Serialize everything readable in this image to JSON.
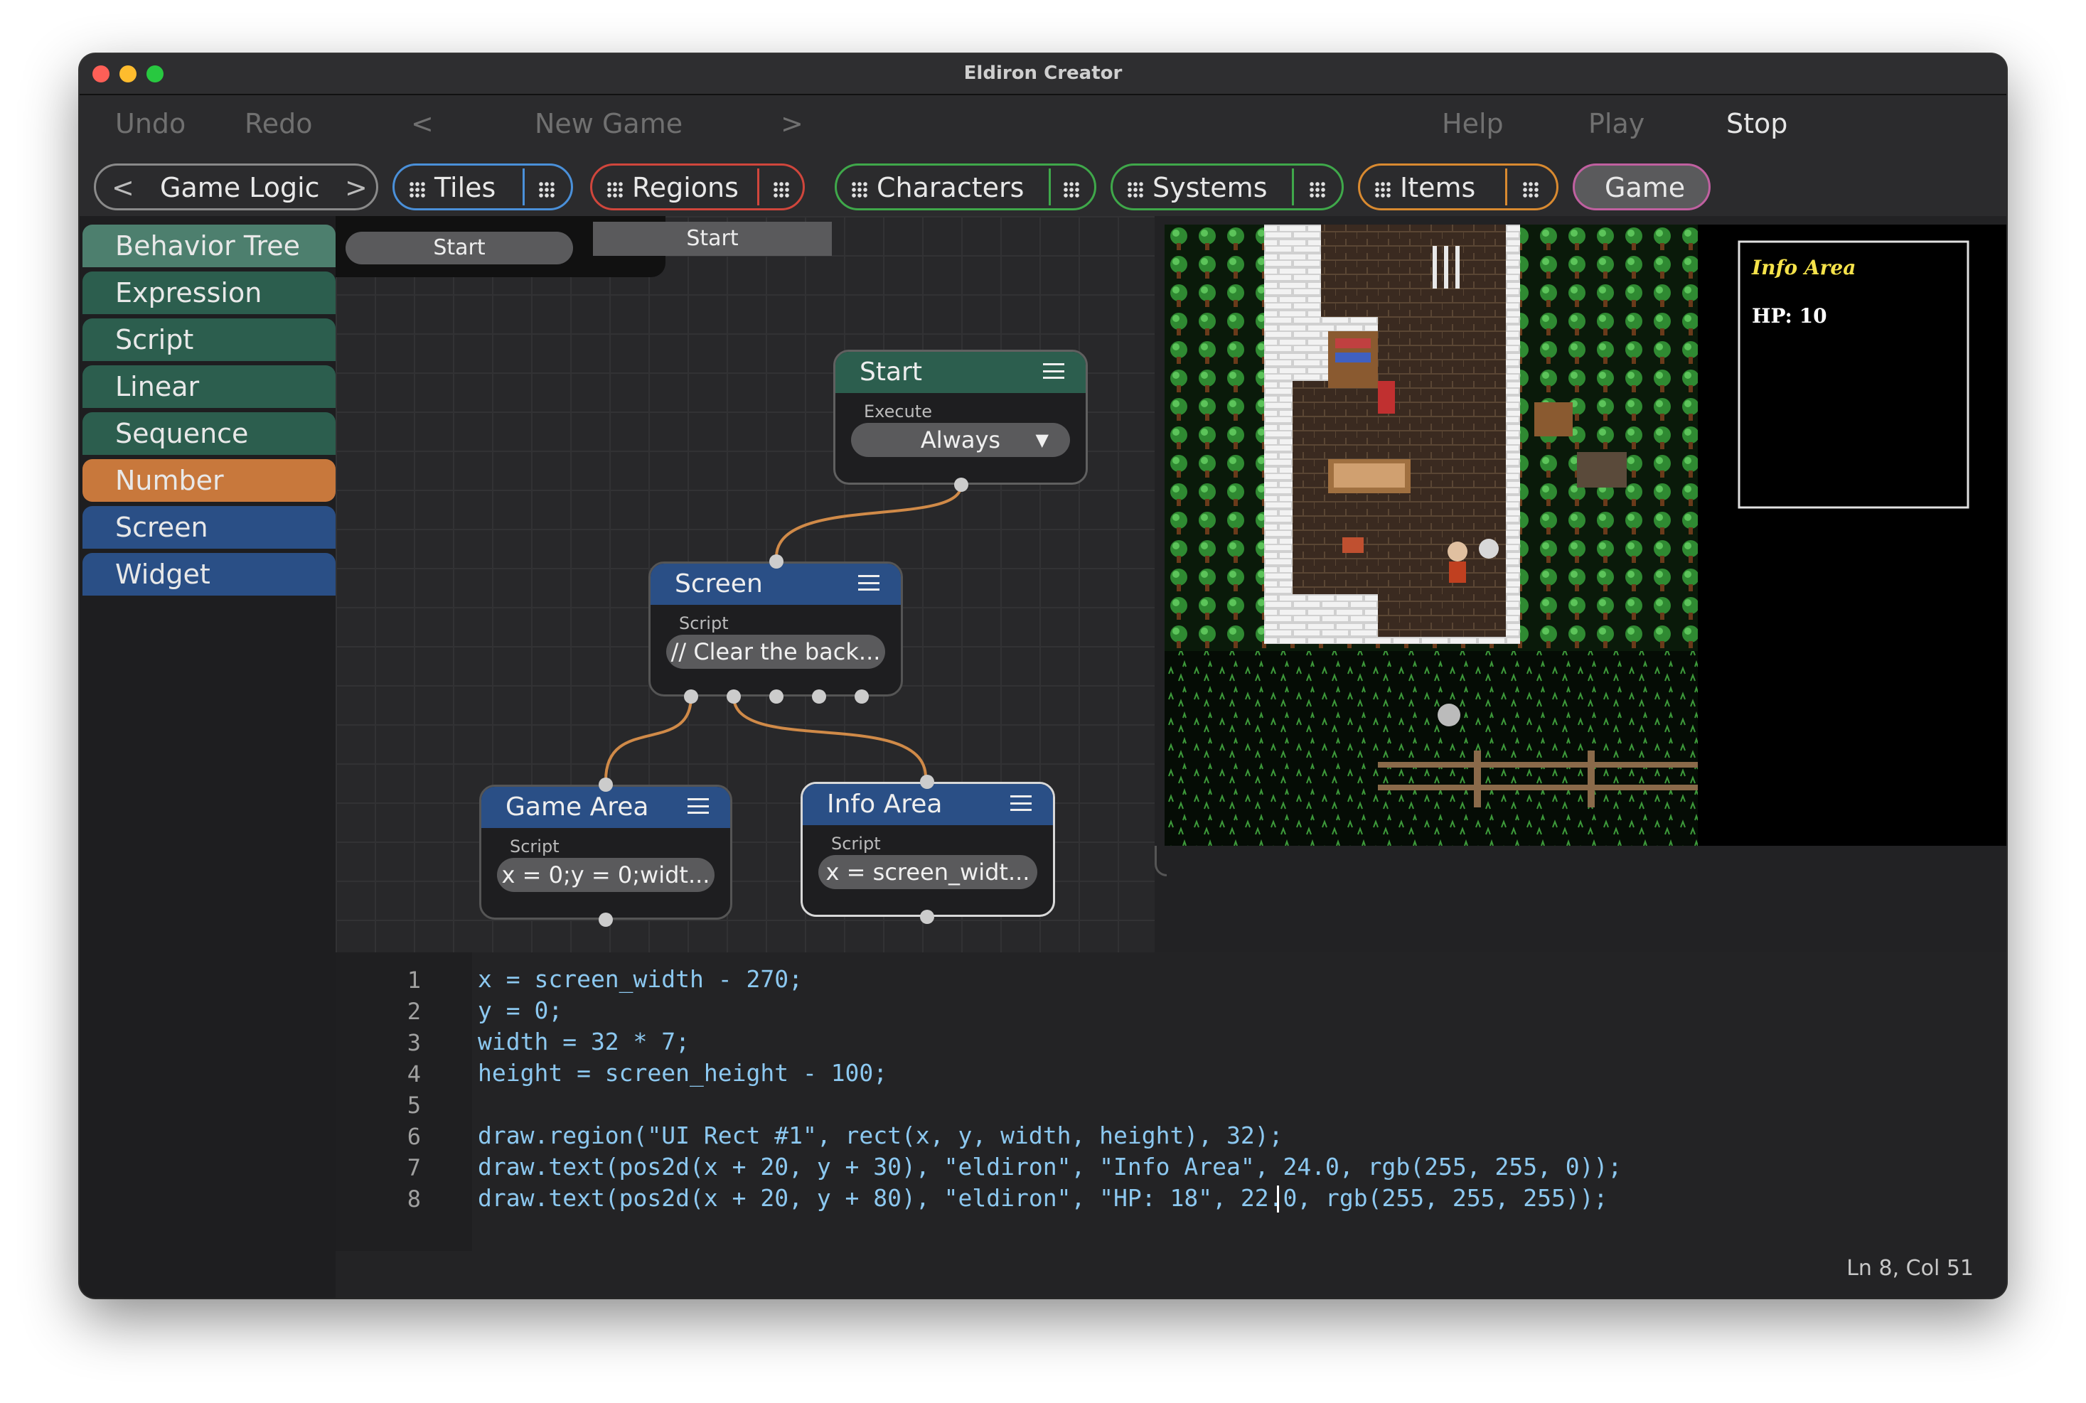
{
  "window": {
    "title": "Eldiron Creator",
    "traffic_colors": [
      "#fe5f57",
      "#febc2e",
      "#28c840"
    ]
  },
  "menubar": {
    "undo": "Undo",
    "redo": "Redo",
    "prev": "<",
    "project": "New Game",
    "next": ">",
    "help": "Help",
    "play": "Play",
    "stop": "Stop"
  },
  "tabs": {
    "behavior_prev": "<",
    "behavior": "Game Logic",
    "behavior_next": ">",
    "tiles": "Tiles",
    "regions": "Regions",
    "characters": "Characters",
    "systems": "Systems",
    "items": "Items",
    "game": "Game",
    "colors": {
      "tiles": "#4a90d9",
      "regions": "#d0463c",
      "characters": "#3fa84a",
      "systems": "#3fa84a",
      "items": "#d98a30",
      "game": "#c060a0"
    }
  },
  "sidebar": {
    "items": [
      {
        "label": "Behavior Tree",
        "color": "#4d7f6e"
      },
      {
        "label": "Expression",
        "color": "#2c5e4e"
      },
      {
        "label": "Script",
        "color": "#2c5e4e"
      },
      {
        "label": "Linear",
        "color": "#2c5e4e"
      },
      {
        "label": "Sequence",
        "color": "#2c5e4e"
      },
      {
        "label": "Number",
        "color": "#c8783c"
      },
      {
        "label": "Screen",
        "color": "#2a4f86"
      },
      {
        "label": "Widget",
        "color": "#2a4f86"
      }
    ]
  },
  "graph": {
    "start_tab": "Start",
    "start_tab_2": "Start",
    "nodes": {
      "start": {
        "title": "Start",
        "sub": "Execute",
        "value": "Always"
      },
      "screen": {
        "title": "Screen",
        "sub": "Script",
        "value": "// Clear the back..."
      },
      "game_area": {
        "title": "Game Area",
        "sub": "Script",
        "value": "x = 0;y = 0;widt..."
      },
      "info_area": {
        "title": "Info Area",
        "sub": "Script",
        "value": "x = screen_widt..."
      }
    }
  },
  "preview": {
    "info_title": "Info Area",
    "hp": "HP: 10"
  },
  "editor": {
    "line_numbers": [
      "1",
      "2",
      "3",
      "4",
      "5",
      "6",
      "7",
      "8"
    ],
    "lines": [
      "x = screen_width - 270;",
      "y = 0;",
      "width = 32 * 7;",
      "height = screen_height - 100;",
      "",
      "draw.region(\"UI Rect #1\", rect(x, y, width, height), 32);",
      "draw.text(pos2d(x + 20, y + 30), \"eldiron\", \"Info Area\", 24.0, rgb(255, 255, 0));",
      "draw.text(pos2d(x + 20, y + 80), \"eldiron\", \"HP: 18\", 22.0, rgb(255, 255, 255));"
    ],
    "status": "Ln 8, Col 51"
  }
}
